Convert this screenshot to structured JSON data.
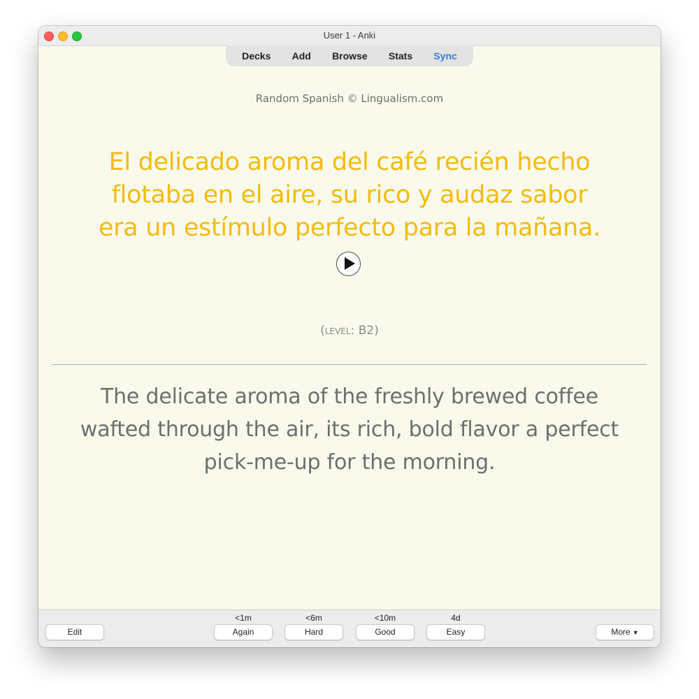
{
  "window": {
    "title": "User 1 - Anki"
  },
  "toolbar": {
    "decks": "Decks",
    "add": "Add",
    "browse": "Browse",
    "stats": "Stats",
    "sync": "Sync"
  },
  "card": {
    "credit": "Random Spanish © Lingualism.com",
    "spanish_lines": [
      "El delicado aroma del café recién hecho",
      "flotaba en el aire, su rico y audaz sabor",
      "era un estímulo perfecto para la mañana."
    ],
    "level_label": "Level:",
    "level_value": "B2",
    "english_lines": [
      "The delicate aroma of the freshly brewed coffee",
      "wafted through the air, its rich, bold flavor a perfect",
      "pick-me-up for the morning."
    ]
  },
  "bottom": {
    "edit": "Edit",
    "more": "More",
    "answers": [
      {
        "interval": "<1m",
        "label": "Again"
      },
      {
        "interval": "<6m",
        "label": "Hard"
      },
      {
        "interval": "<10m",
        "label": "Good"
      },
      {
        "interval": "4d",
        "label": "Easy"
      }
    ]
  },
  "colors": {
    "card_background": "#fafaec",
    "spanish_text": "#f2bb0f",
    "english_text": "#6e6e6e",
    "sync_accent": "#2f7de1"
  },
  "icons": {
    "play": "play-icon",
    "more_caret": "caret-down-icon"
  }
}
